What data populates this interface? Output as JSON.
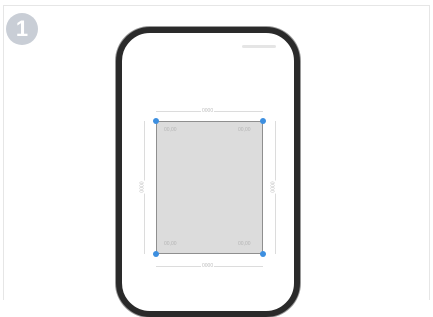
{
  "step": {
    "number": "1"
  },
  "phone": {},
  "crop": {
    "top_dim": "0000",
    "bottom_dim": "0000",
    "left_dim": "0000",
    "right_dim": "0000",
    "corner_tl": "00,00",
    "corner_tr": "00,00",
    "corner_bl": "00,00",
    "corner_br": "00,00"
  },
  "colors": {
    "handle": "#3d8fe0",
    "badge": "#c9ced6",
    "phone_frame": "#2a2a2a",
    "crop_fill": "#dcdcdc"
  }
}
